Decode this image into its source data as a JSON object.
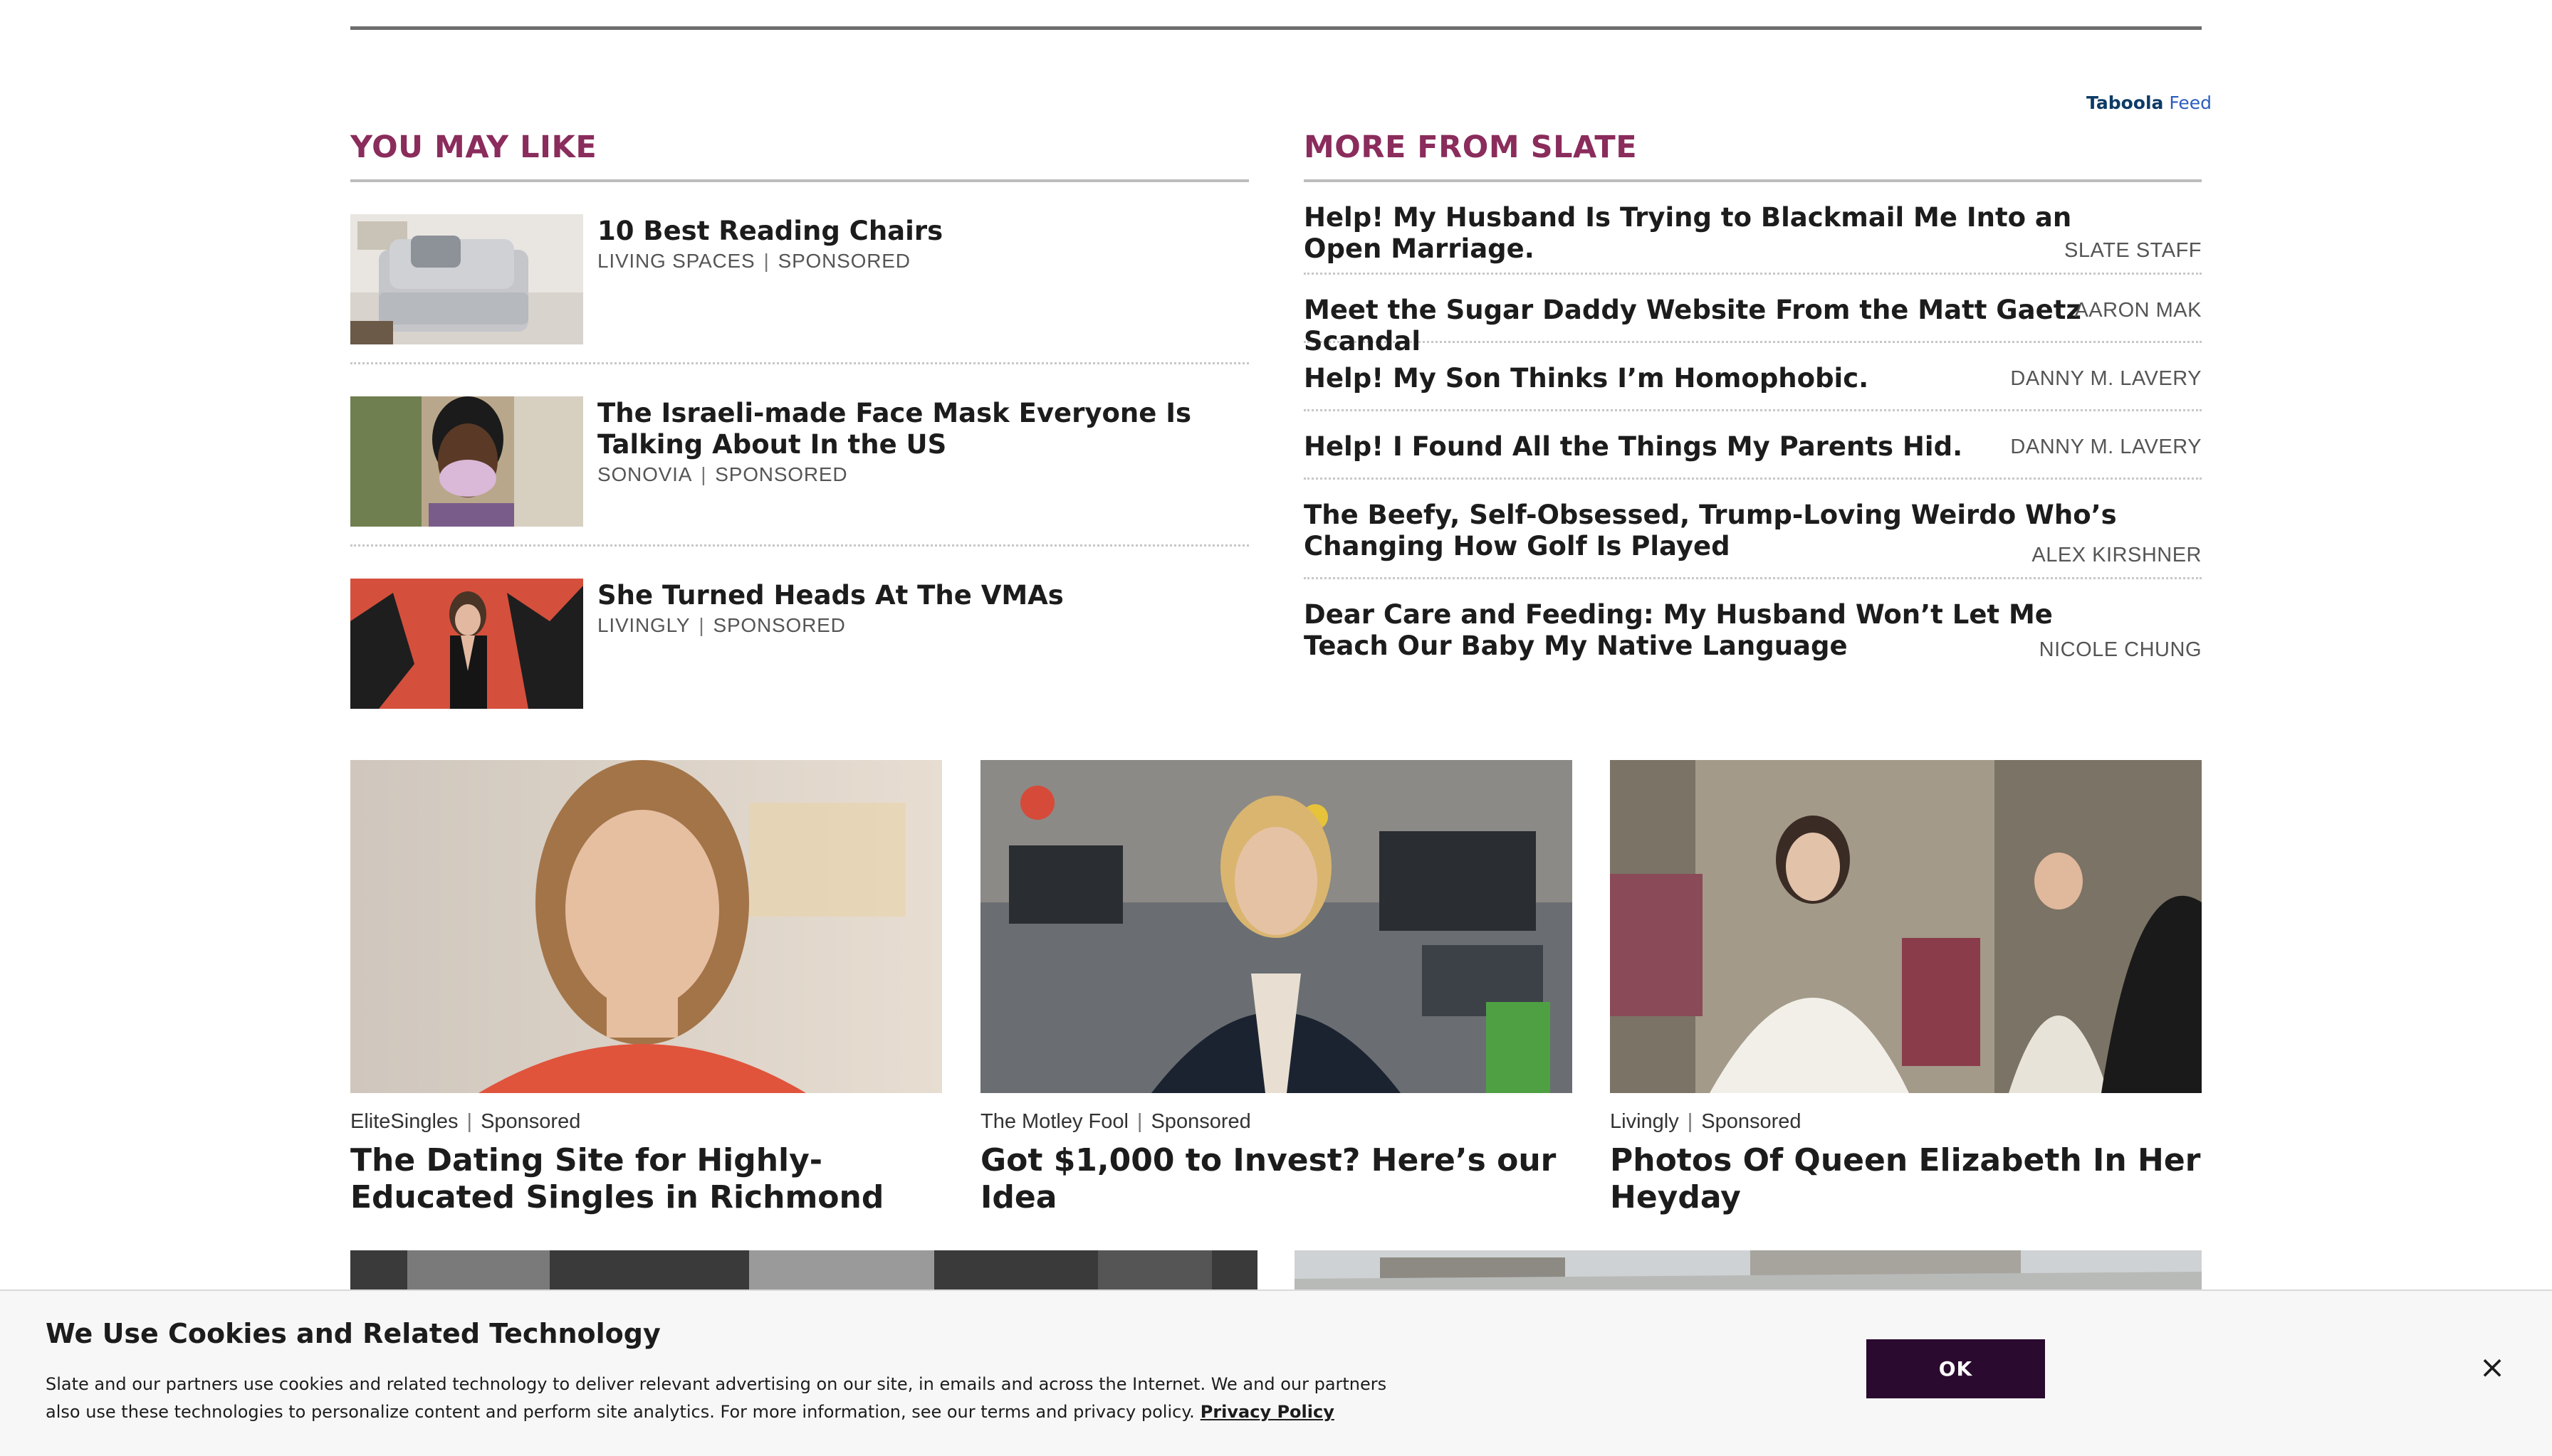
{
  "taboola": {
    "brand": "Taboola",
    "feed": "Feed"
  },
  "you_may_like": {
    "heading": "YOU MAY LIKE",
    "items": [
      {
        "title": "10 Best Reading Chairs",
        "source": "LIVING SPACES",
        "tag": "SPONSORED",
        "image": "gray-armchair-photo"
      },
      {
        "title": "The Israeli-made Face Mask Everyone Is Talking About In the US",
        "source": "SONOVIA",
        "tag": "SPONSORED",
        "image": "woman-face-mask-photo"
      },
      {
        "title": "She Turned Heads At The VMAs",
        "source": "LIVINGLY",
        "tag": "SPONSORED",
        "image": "red-carpet-photo"
      }
    ]
  },
  "more_from_slate": {
    "heading": "MORE FROM SLATE",
    "items": [
      {
        "title": "Help! My Husband Is Trying to Blackmail Me Into an Open Marriage.",
        "author": "SLATE STAFF"
      },
      {
        "title": "Meet the Sugar Daddy Website From the Matt Gaetz Scandal",
        "author": "AARON MAK"
      },
      {
        "title": "Help! My Son Thinks I’m Homophobic.",
        "author": "DANNY M. LAVERY"
      },
      {
        "title": "Help! I Found All the Things My Parents Hid.",
        "author": "DANNY M. LAVERY"
      },
      {
        "title": "The Beefy, Self-Obsessed, Trump-Loving Weirdo Who’s Changing How Golf Is Played",
        "author": "ALEX KIRSHNER"
      },
      {
        "title": "Dear Care and Feeding: My Husband Won’t Let Me Teach Our Baby My Native Language",
        "author": "NICOLE CHUNG"
      }
    ]
  },
  "cards": [
    {
      "source": "EliteSingles",
      "tag": "Sponsored",
      "title": "The Dating Site for Highly-Educated Singles in Richmond",
      "image": "smiling-woman-photo"
    },
    {
      "source": "The Motley Fool",
      "tag": "Sponsored",
      "title": "Got $1,000 to Invest? Here’s our Idea",
      "image": "newsroom-presenter-photo"
    },
    {
      "source": "Livingly",
      "tag": "Sponsored",
      "title": "Photos Of Queen Elizabeth In Her Heyday",
      "image": "queen-elizabeth-photo"
    }
  ],
  "cookie": {
    "title": "We Use Cookies and Related Technology",
    "body": "Slate and our partners use cookies and related technology to deliver relevant advertising on our site, in emails and across the Internet. We and our partners also use these technologies to personalize content and perform site analytics. For more information, see our terms and privacy policy.",
    "link": "Privacy Policy",
    "ok": "OK",
    "close": "×"
  },
  "colors": {
    "heading": "#8a2c5c",
    "ok_button": "#2a0a2e"
  }
}
